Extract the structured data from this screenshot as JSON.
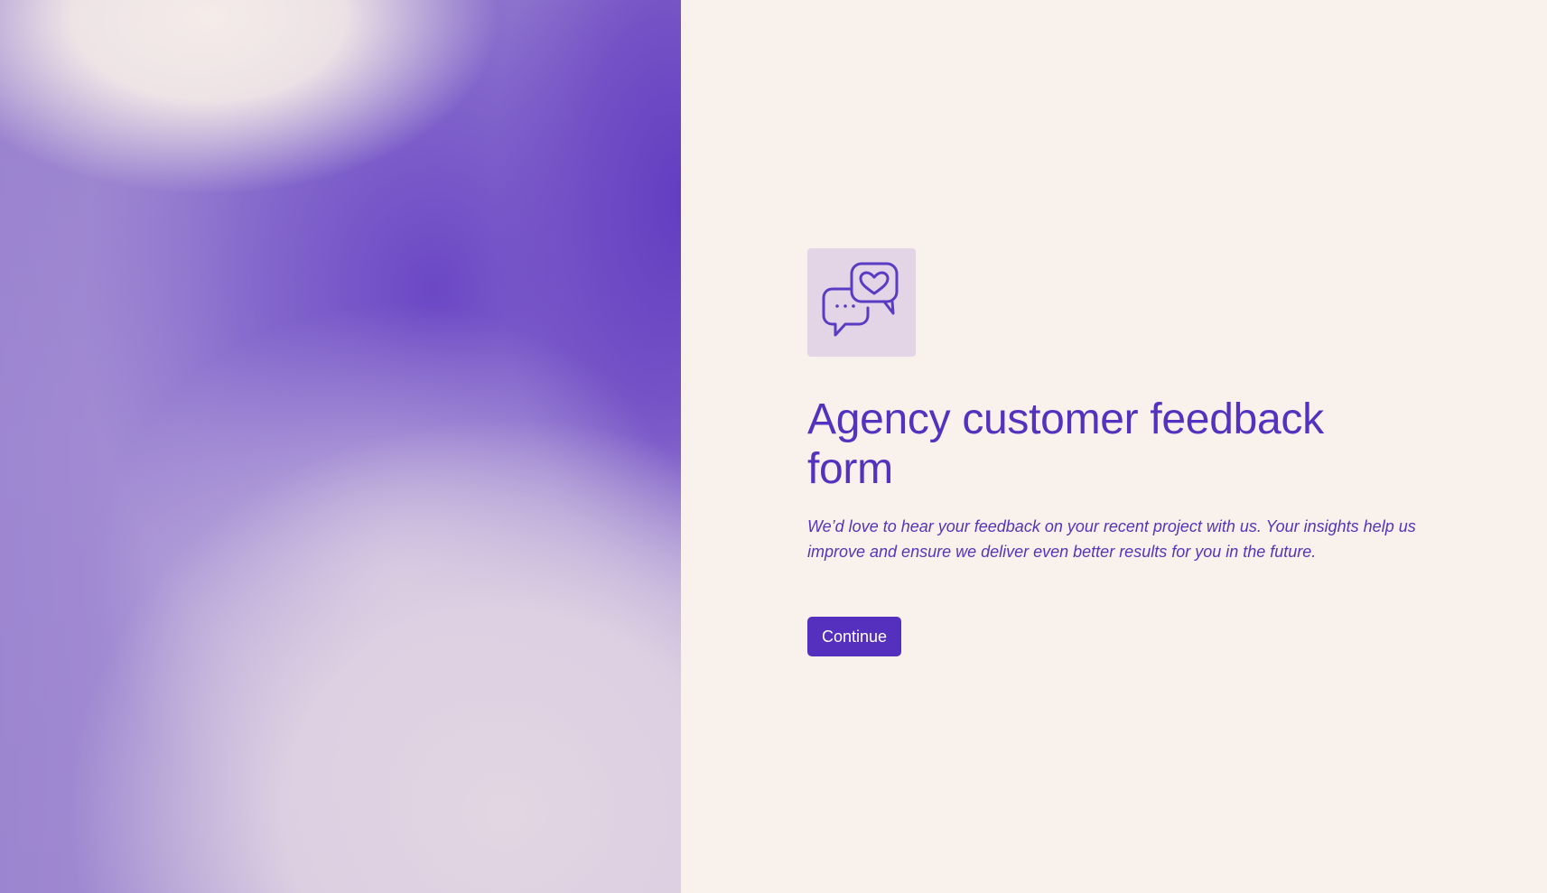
{
  "form": {
    "title": "Agency customer feedback form",
    "description": "We’d love to hear your feedback on your recent project with us. Your insights help us improve and ensure we deliver even better results for you in the future.",
    "continue_label": "Continue",
    "icon": "chat-bubbles-heart-icon"
  },
  "colors": {
    "accent": "#5232bf",
    "page_background": "#f8f1ec",
    "icon_tile": "#e3d4e6"
  }
}
